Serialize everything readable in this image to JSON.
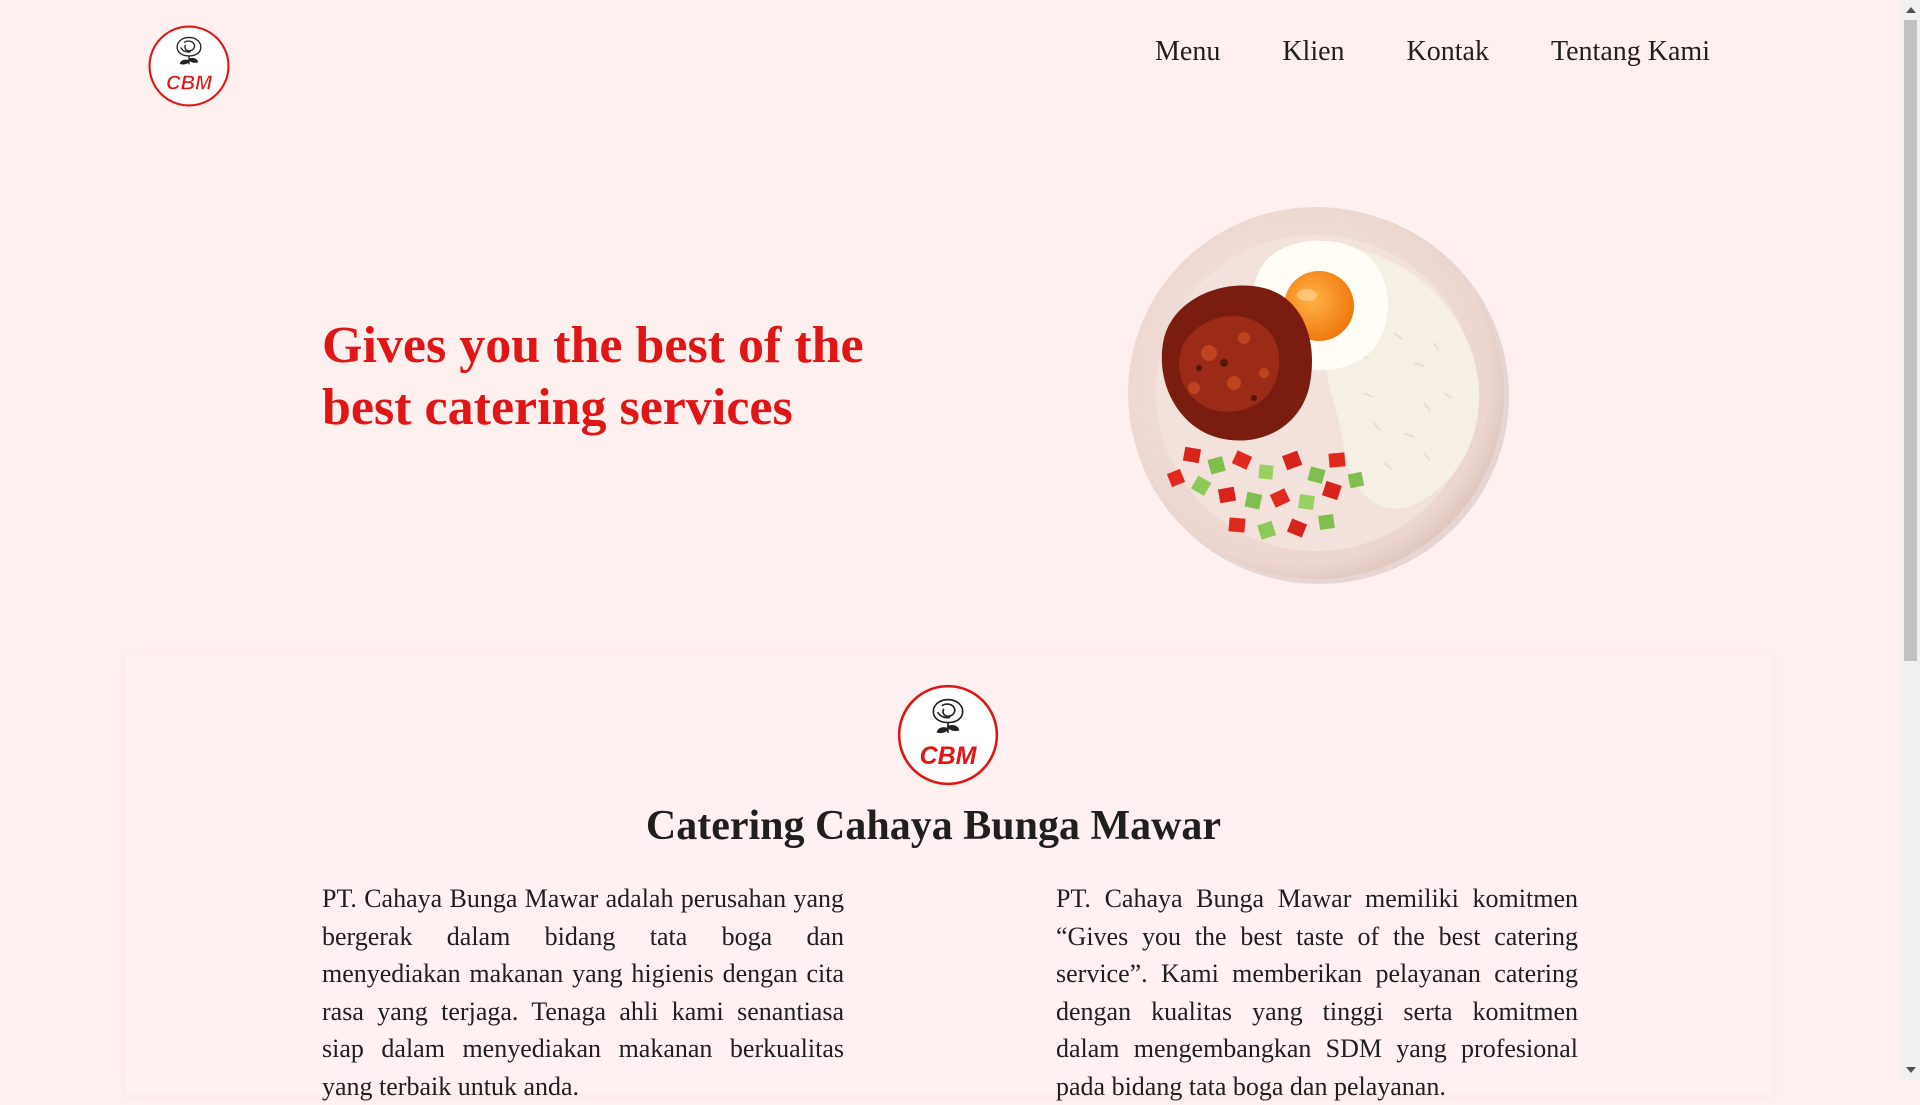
{
  "brand": {
    "logo_text": "CBM"
  },
  "nav": {
    "items": [
      {
        "label": "Menu"
      },
      {
        "label": "Klien"
      },
      {
        "label": "Kontak"
      },
      {
        "label": "Tentang Kami"
      }
    ]
  },
  "hero": {
    "title": "Gives you the best of the best catering services"
  },
  "about": {
    "logo_text": "CBM",
    "title": "Catering Cahaya Bunga Mawar",
    "left_paragraph": "PT. Cahaya Bunga Mawar adalah perusahan yang bergerak dalam bidang tata boga dan menyediakan makanan yang higienis dengan cita rasa yang terjaga. Tenaga ahli kami senantiasa siap dalam menyediakan makanan berkualitas yang terbaik untuk anda.",
    "right_paragraph": "PT. Cahaya Bunga Mawar memiliki komitmen “Gives you the best taste of the best catering service”. Kami memberikan pelayanan catering dengan kualitas yang tinggi serta komitmen dalam mengembangkan SDM yang profesional pada bidang tata boga dan pelayanan."
  },
  "colors": {
    "background": "#fff0f0",
    "accent": "#e01616",
    "text": "#1f1f1f"
  },
  "icons": {
    "logo": "rose-logo-icon",
    "hero_image": "nasi-plate-image",
    "scroll_up": "triangle-up-icon",
    "scroll_down": "triangle-down-icon"
  }
}
